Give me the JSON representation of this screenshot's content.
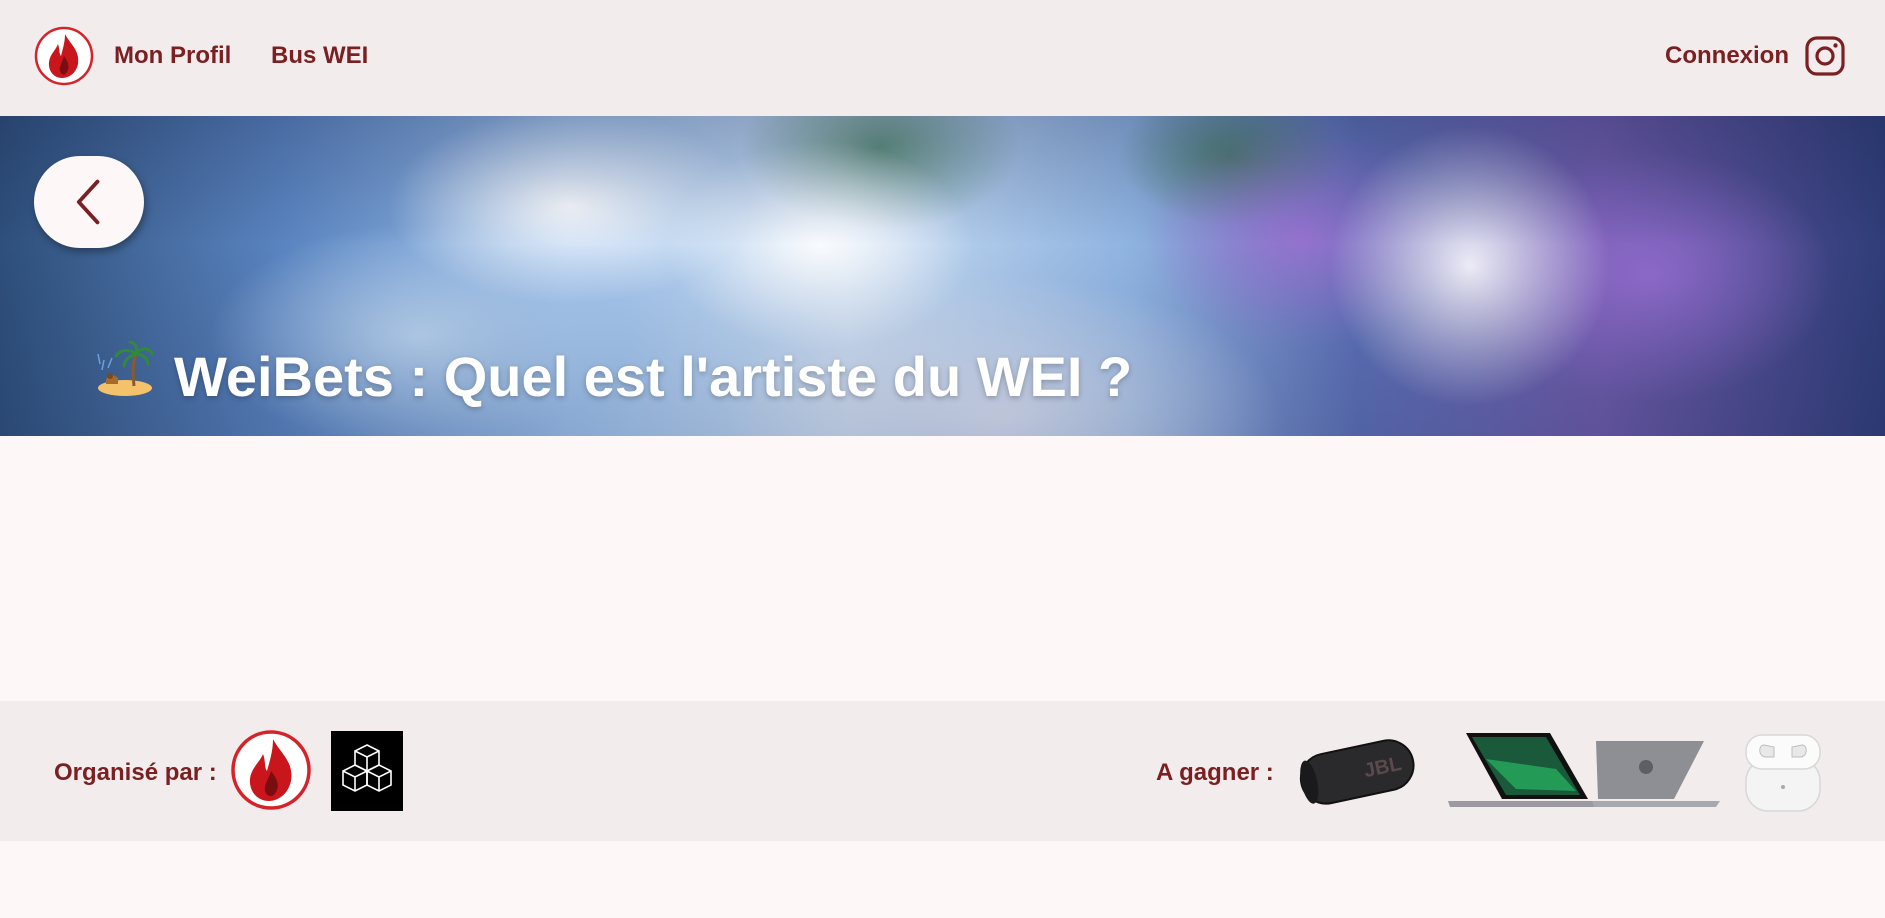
{
  "nav": {
    "logo_icon": "flame-logo-icon",
    "links": {
      "profil": "Mon Profil",
      "bus": "Bus WEI",
      "connexion": "Connexion"
    },
    "instagram_icon": "instagram-icon"
  },
  "hero": {
    "title": "WeiBets : Quel est l'artiste du WEI ?",
    "back_icon": "chevron-left-icon",
    "emoji_icon": "island-emoji-icon"
  },
  "footer": {
    "organized_by_label": "Organisé par :",
    "to_win_label": "A gagner :",
    "prizes": [
      "speaker",
      "laptop",
      "earbuds"
    ]
  },
  "colors": {
    "brand": "#7a1f22",
    "brand_red": "#d4242a",
    "nav_bg": "#f3ecec",
    "page_bg": "#fdf8f7"
  }
}
